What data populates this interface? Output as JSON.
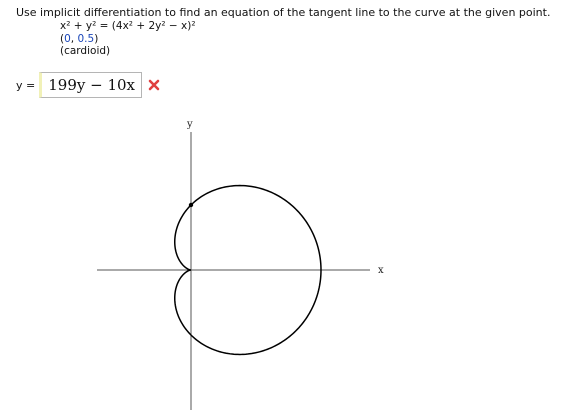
{
  "question": "Use implicit differentiation to find an equation of the tangent line to the curve at the given point.",
  "equation": {
    "lhs": "x² + y² = (4x² + 2y² − x)²",
    "point": {
      "open": "(",
      "x": "0",
      "sep": ", ",
      "y": "0.5",
      "close": ")"
    },
    "curve_name": "(cardioid)"
  },
  "answer": {
    "label": "y =",
    "value": "199y − 10x",
    "status": "incorrect",
    "status_icon": "x-mark-icon",
    "status_color": "#e04040"
  },
  "graph": {
    "x_axis_label": "x",
    "y_axis_label": "y",
    "curve_color": "#000000",
    "axis_color": "#555555"
  }
}
